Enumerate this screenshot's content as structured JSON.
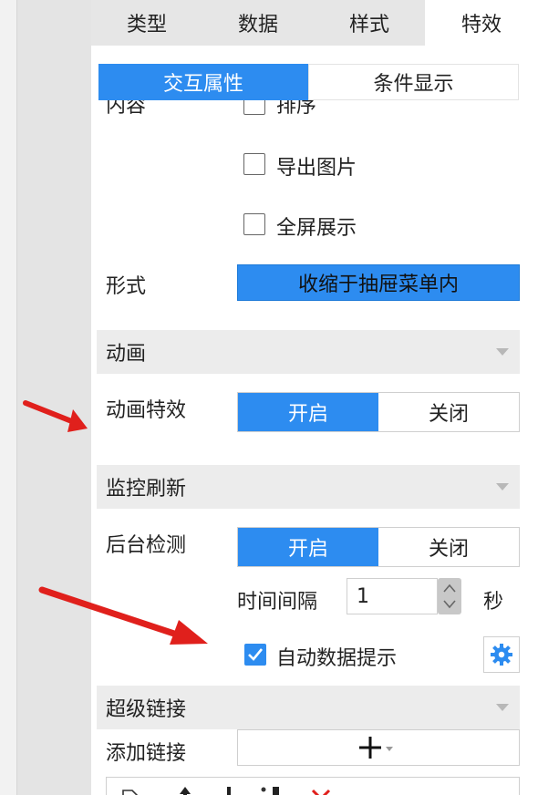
{
  "tabs": [
    {
      "label": "类型"
    },
    {
      "label": "数据"
    },
    {
      "label": "样式"
    },
    {
      "label": "特效"
    }
  ],
  "subtabs": {
    "interactive": "交互属性",
    "conditional": "条件显示"
  },
  "content": {
    "partial_label": "内容",
    "partial_option": "排序",
    "export_image": "导出图片",
    "fullscreen": "全屏展示"
  },
  "form": {
    "label": "形式",
    "value": "收缩于抽屉菜单内"
  },
  "animation": {
    "section": "动画",
    "effect_label": "动画特效",
    "on": "开启",
    "off": "关闭"
  },
  "monitor": {
    "section": "监控刷新",
    "bg_label": "后台检测",
    "on": "开启",
    "off": "关闭",
    "interval_label": "时间间隔",
    "interval_value": "1",
    "interval_unit": "秒",
    "auto_hint": "自动数据提示"
  },
  "hyperlink": {
    "section": "超级链接",
    "add_label": "添加链接"
  },
  "colors": {
    "accent": "#2d8cf0",
    "arrow": "#e0201c"
  }
}
